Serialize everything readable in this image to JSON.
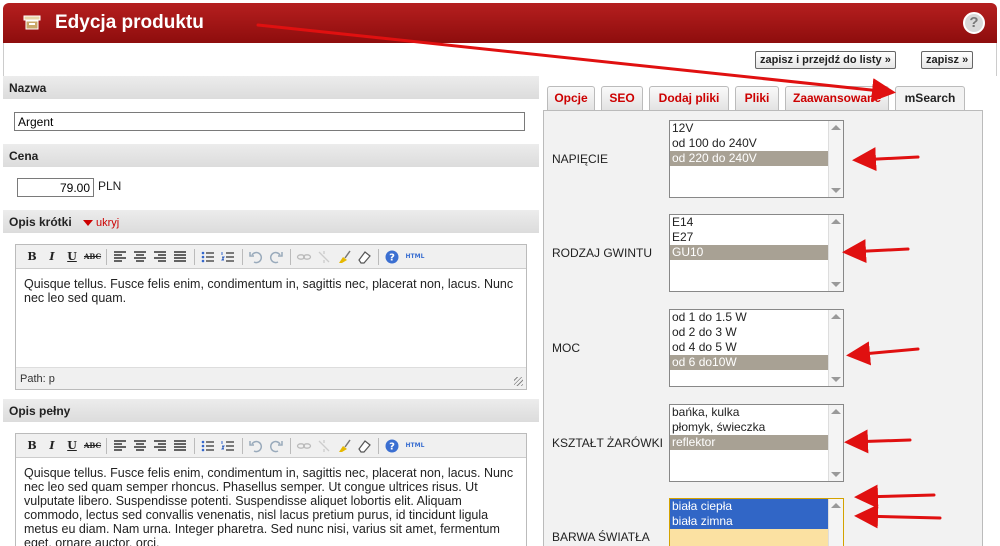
{
  "window": {
    "title": "Edycja produktu",
    "help_label": "?"
  },
  "toolbar": {
    "save_list_label": "zapisz i przejdź do listy »",
    "save_label": "zapisz »"
  },
  "fields": {
    "name": {
      "label": "Nazwa",
      "value": "Argent"
    },
    "price": {
      "label": "Cena",
      "value": "79.00",
      "unit": "PLN"
    },
    "short_desc": {
      "label": "Opis krótki",
      "toggle": "ukryj",
      "content": "Quisque tellus. Fusce felis enim, condimentum in, sagittis nec, placerat non, lacus. Nunc nec leo sed quam.",
      "path": "Path: p"
    },
    "full_desc": {
      "label": "Opis pełny",
      "content": "Quisque tellus. Fusce felis enim, condimentum in, sagittis nec, placerat non, lacus. Nunc nec leo sed quam semper rhoncus. Phasellus semper. Ut congue ultrices risus. Ut vulputate libero. Suspendisse potenti. Suspendisse aliquet lobortis elit. Aliquam commodo, lectus sed convallis venenatis, nisl lacus pretium purus, id tincidunt ligula metus eu diam. Nam urna. Integer pharetra. Sed nunc nisi, varius sit amet, fermentum eget, ornare auctor, orci."
    }
  },
  "editor_toolbar": {
    "bold": "B",
    "italic": "I",
    "underline": "U",
    "strike": "ABC",
    "html": "HTML"
  },
  "tabs": [
    {
      "label": "Opcje"
    },
    {
      "label": "SEO"
    },
    {
      "label": "Dodaj pliki"
    },
    {
      "label": "Pliki"
    },
    {
      "label": "Zaawansowane"
    },
    {
      "label": "mSearch"
    }
  ],
  "msearch": {
    "napiecie": {
      "label": "NAPIĘCIE",
      "options": [
        "12V",
        "od 100 do 240V",
        "od 220 do 240V"
      ]
    },
    "gwint": {
      "label": "RODZAJ GWINTU",
      "options": [
        "E14",
        "E27",
        "GU10"
      ]
    },
    "moc": {
      "label": "MOC",
      "options": [
        "od 1 do 1.5 W",
        "od 2 do 3 W",
        "od 4 do 5 W",
        "od 6 do10W"
      ]
    },
    "ksztalt": {
      "label": "KSZTAŁT ŻARÓWKI",
      "options": [
        "bańka, kulka",
        "płomyk, świeczka",
        "reflektor"
      ]
    },
    "barwa": {
      "label": "BARWA ŚWIATŁA",
      "options": [
        "biała ciepła",
        "biała zimna"
      ]
    }
  },
  "colors": {
    "header_red": "#a31616",
    "arrow_red": "#e01010",
    "selected_gray": "#a8a194",
    "selected_blue": "#3166c6"
  }
}
